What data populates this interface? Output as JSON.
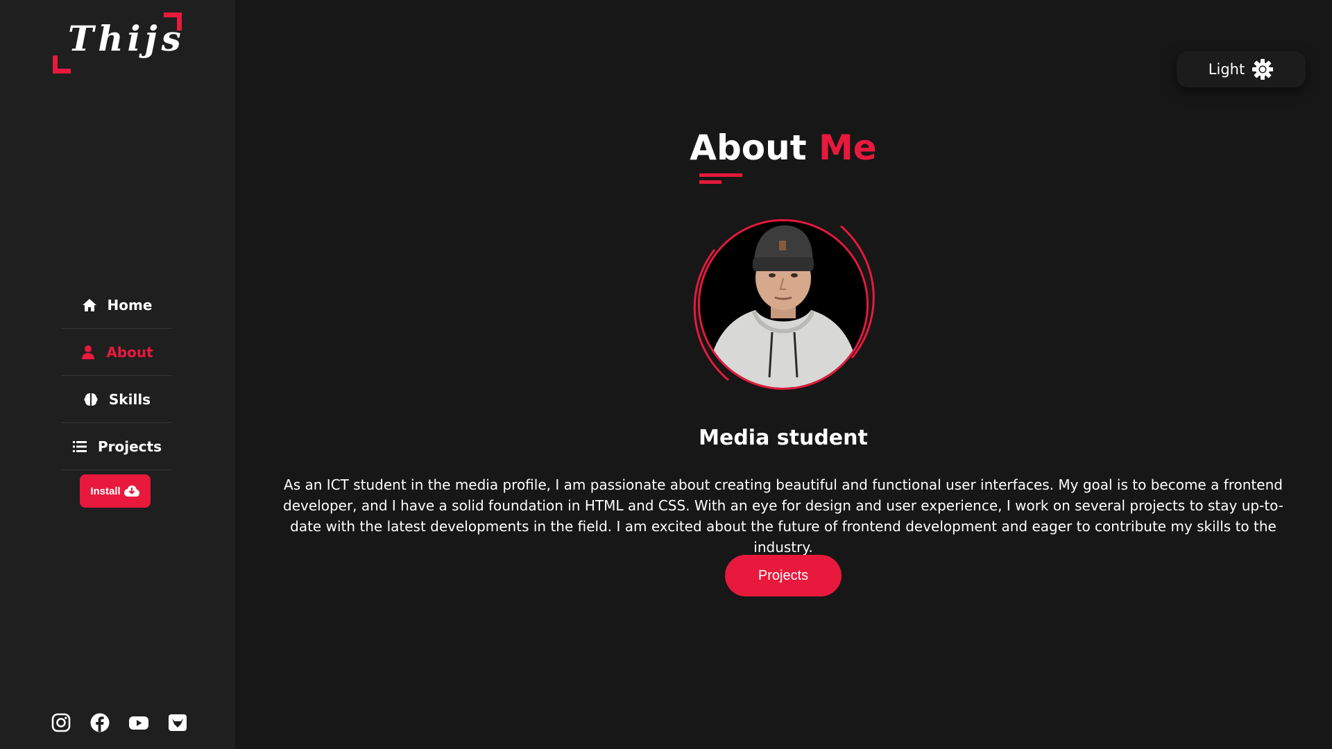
{
  "theme": {
    "accent": "#e8193c",
    "background": "#171717",
    "sidebar_background": "#1f1f1f"
  },
  "logo": {
    "text": "Thijs"
  },
  "sidebar": {
    "nav": [
      {
        "label": "Home",
        "icon": "home-icon",
        "active": false
      },
      {
        "label": "About",
        "icon": "user-icon",
        "active": true
      },
      {
        "label": "Skills",
        "icon": "brain-icon",
        "active": false
      },
      {
        "label": "Projects",
        "icon": "list-icon",
        "active": false
      }
    ],
    "install_label": "Install",
    "socials": [
      {
        "icon": "instagram-icon"
      },
      {
        "icon": "facebook-icon"
      },
      {
        "icon": "youtube-icon"
      },
      {
        "icon": "gitlab-icon"
      }
    ]
  },
  "theme_toggle": {
    "label": "Light",
    "icon": "sun-gear-icon"
  },
  "about": {
    "title_part1": "About",
    "title_part2": "Me",
    "subtitle": "Media student",
    "description": "As an ICT student in the media profile, I am passionate about creating beautiful and functional user interfaces. My goal is to become a frontend developer, and I have a solid foundation in HTML and CSS. With an eye for design and user experience, I work on several projects to stay up-to-date with the latest developments in the field. I am excited about the future of frontend development and eager to contribute my skills to the industry.",
    "cta_label": "Projects"
  }
}
